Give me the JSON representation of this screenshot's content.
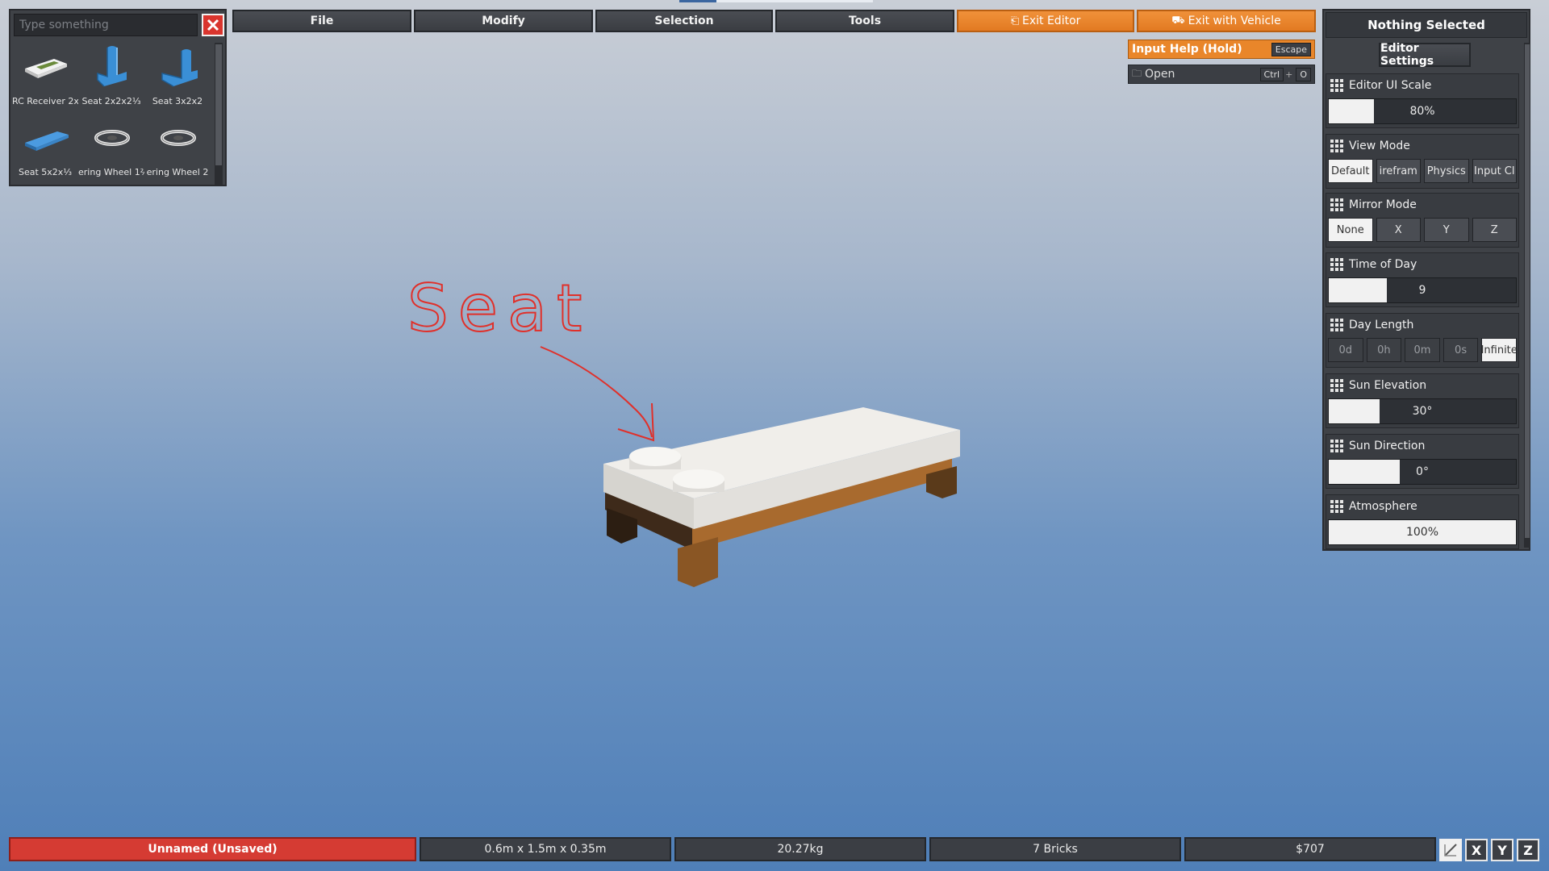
{
  "search": {
    "placeholder": "Type something"
  },
  "bricks": [
    {
      "label": "RC Receiver 2x"
    },
    {
      "label": "Seat 2x2x2⅓"
    },
    {
      "label": "Seat 3x2x2"
    },
    {
      "label": "Seat 5x2x⅓"
    },
    {
      "label": "ering Wheel 1⅔"
    },
    {
      "label": "ering Wheel 2"
    }
  ],
  "menu": {
    "file": "File",
    "modify": "Modify",
    "selection": "Selection",
    "tools": "Tools",
    "exit_editor": "Exit Editor",
    "exit_vehicle": "Exit with Vehicle"
  },
  "input_help": {
    "label": "Input Help (Hold)",
    "key": "Escape"
  },
  "open": {
    "label": "Open",
    "key1": "Ctrl",
    "plus": "+",
    "key2": "O"
  },
  "panel": {
    "header": "Nothing Selected",
    "editor_settings": "Editor Settings",
    "ui_scale": {
      "title": "Editor UI Scale",
      "value": "80%",
      "fraction": 0.24
    },
    "view_mode": {
      "title": "View Mode",
      "options": [
        "Default",
        "irefram",
        "Physics",
        "Input Cl"
      ],
      "active": 0
    },
    "mirror_mode": {
      "title": "Mirror Mode",
      "options": [
        "None",
        "X",
        "Y",
        "Z"
      ],
      "active": 0
    },
    "time_of_day": {
      "title": "Time of Day",
      "value": "9",
      "fraction": 0.31
    },
    "day_length": {
      "title": "Day Length",
      "options": [
        "0d",
        "0h",
        "0m",
        "0s",
        "Infinite"
      ],
      "active": 4
    },
    "sun_elevation": {
      "title": "Sun Elevation",
      "value": "30°",
      "fraction": 0.27
    },
    "sun_direction": {
      "title": "Sun Direction",
      "value": "0°",
      "fraction": 0.38
    },
    "atmosphere": {
      "title": "Atmosphere",
      "value": "100%",
      "fraction": 1.0
    }
  },
  "annotation": {
    "text": "Seat"
  },
  "status": {
    "name": "Unnamed (Unsaved)",
    "size": "0.6m x 1.5m x 0.35m",
    "mass": "20.27kg",
    "bricks": "7 Bricks",
    "cost": "$707"
  },
  "axes": [
    "X",
    "Y",
    "Z"
  ]
}
